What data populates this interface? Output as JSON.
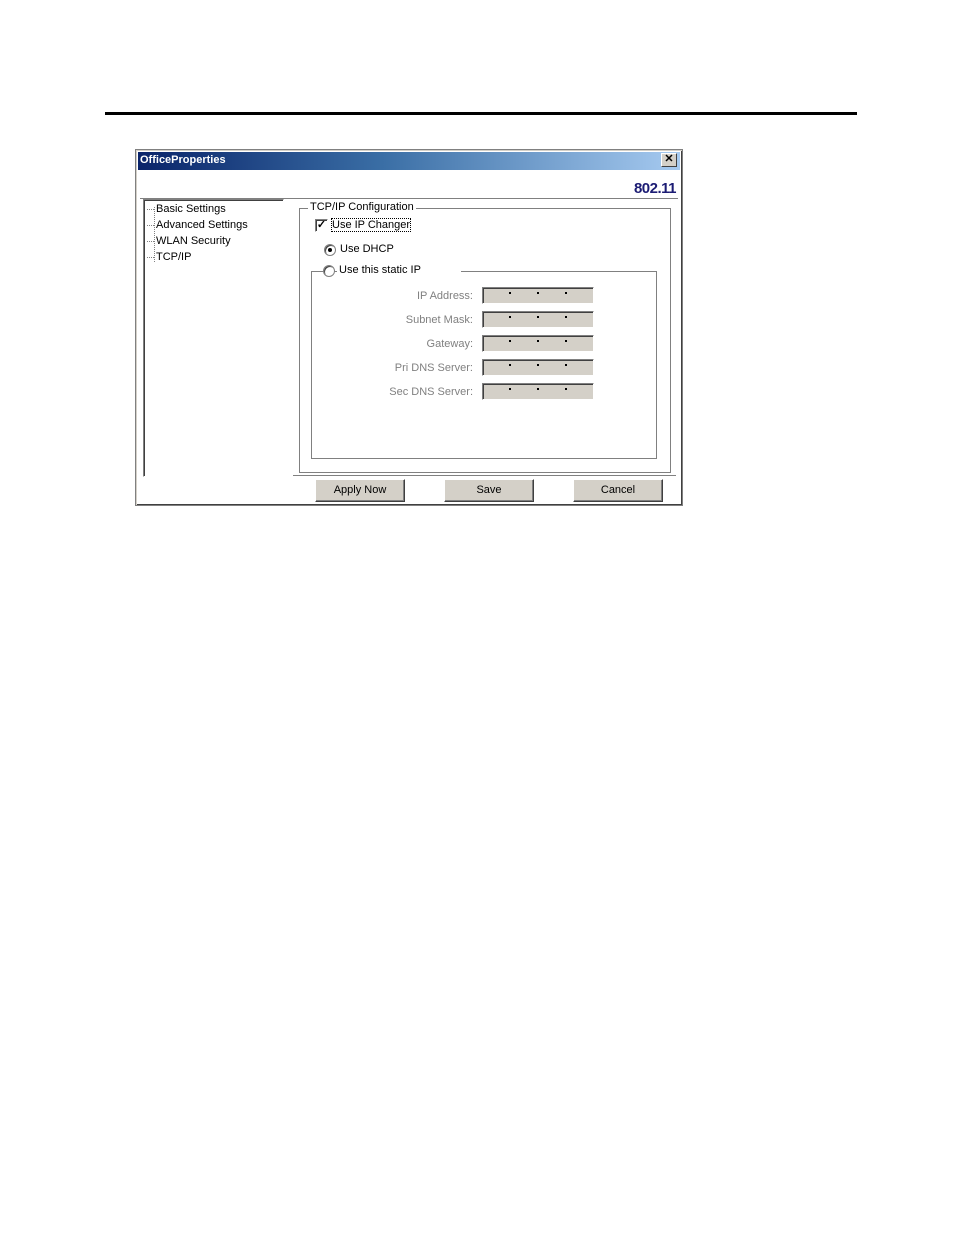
{
  "window": {
    "title": "OfficeProperties",
    "close_icon": "close-icon",
    "brand": "802.11"
  },
  "tree": {
    "items": [
      {
        "label": "Basic Settings"
      },
      {
        "label": "Advanced Settings"
      },
      {
        "label": "WLAN Security"
      },
      {
        "label": "TCP/IP"
      }
    ]
  },
  "tcpip": {
    "group_title": "TCP/IP Configuration",
    "use_ip_changer": {
      "label": "Use IP Changer",
      "checked": true,
      "mark": "✓"
    },
    "use_dhcp": {
      "label": "Use DHCP",
      "selected": true
    },
    "use_static": {
      "label": "Use this static IP",
      "selected": false
    },
    "fields": [
      {
        "label": "IP Address:",
        "value": ""
      },
      {
        "label": "Subnet Mask:",
        "value": ""
      },
      {
        "label": "Gateway:",
        "value": ""
      },
      {
        "label": "Pri DNS Server:",
        "value": ""
      },
      {
        "label": "Sec DNS Server:",
        "value": ""
      }
    ]
  },
  "buttons": {
    "apply": "Apply Now",
    "save": "Save",
    "cancel": "Cancel"
  },
  "colors": {
    "title_start": "#0a246a",
    "title_end": "#a6caf0",
    "brand": "#1c1c74",
    "disabled_field": "#d4d0c8"
  }
}
